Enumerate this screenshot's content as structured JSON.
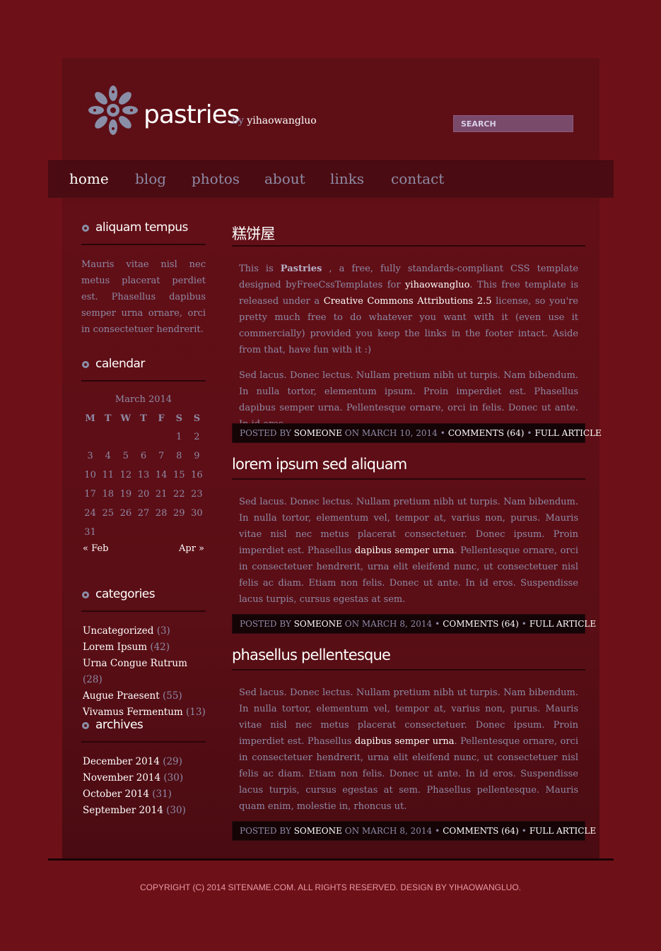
{
  "header": {
    "title": "pastries",
    "by_prefix": "by",
    "by_name": "yihaowangluo",
    "search_label": "SEARCH"
  },
  "nav": {
    "items": [
      {
        "label": "home",
        "active": true
      },
      {
        "label": "blog"
      },
      {
        "label": "photos"
      },
      {
        "label": "about"
      },
      {
        "label": "links"
      },
      {
        "label": "contact"
      }
    ]
  },
  "sidebar": {
    "about": {
      "title": "aliquam tempus",
      "text": "Mauris vitae nisl nec metus placerat perdiet est. Phasellus dapibus semper urna ornare, orci in consectetuer hendrerit."
    },
    "calendar": {
      "title": "calendar",
      "month": "March 2014",
      "days": [
        "M",
        "T",
        "W",
        "T",
        "F",
        "S",
        "S"
      ],
      "weeks": [
        [
          "",
          "",
          "",
          "",
          "",
          "1",
          "2"
        ],
        [
          "3",
          "4",
          "5",
          "6",
          "7",
          "8",
          "9"
        ],
        [
          "10",
          "11",
          "12",
          "13",
          "14",
          "15",
          "16"
        ],
        [
          "17",
          "18",
          "19",
          "20",
          "21",
          "22",
          "23"
        ],
        [
          "24",
          "25",
          "26",
          "27",
          "28",
          "29",
          "30"
        ],
        [
          "31",
          "",
          "",
          "",
          "",
          "",
          ""
        ]
      ],
      "prev": "« Feb",
      "next": "Apr »"
    },
    "categories": {
      "title": "categories",
      "items": [
        {
          "label": "Uncategorized",
          "count": "(3)"
        },
        {
          "label": "Lorem Ipsum",
          "count": "(42)"
        },
        {
          "label": "Urna Congue Rutrum",
          "count": "(28)"
        },
        {
          "label": "Augue Praesent",
          "count": "(55)"
        },
        {
          "label": "Vivamus Fermentum",
          "count": "(13)"
        }
      ]
    },
    "archives": {
      "title": "archives",
      "items": [
        {
          "label": "December 2014",
          "count": "(29)"
        },
        {
          "label": "November 2014",
          "count": "(30)"
        },
        {
          "label": "October 2014",
          "count": "(31)"
        },
        {
          "label": "September 2014",
          "count": "(30)"
        }
      ]
    }
  },
  "posts": [
    {
      "title": "糕饼屋",
      "p1_a": "This is ",
      "p1_b": "Pastries",
      "p1_c": " , a free, fully standards-compliant CSS template designed byFreeCssTemplates for ",
      "p1_d": "yihaowangluo",
      "p1_e": ". This free template is released under a ",
      "p1_f": "Creative Commons Attributions 2.5",
      "p1_g": " license, so you're pretty much free to do whatever you want with it (even use it commercially) provided you keep the links in the footer intact. Aside from that, have fun with it :)",
      "p2": "Sed lacus. Donec lectus. Nullam pretium nibh ut turpis. Nam bibendum. In nulla tortor, elementum ipsum. Proin imperdiet est. Phasellus dapibus semper urna. Pellentesque ornare, orci in felis. Donec ut ante. In id eros.",
      "meta": {
        "posted_by": "POSTED BY",
        "author": "SOMEONE",
        "on": "ON MARCH 10, 2014",
        "comments": "COMMENTS (64)",
        "full": "FULL ARTICLE"
      }
    },
    {
      "title": "lorem ipsum sed aliquam",
      "p1_a": "Sed lacus. Donec lectus. Nullam pretium nibh ut turpis. Nam bibendum. In nulla tortor, elementum vel, tempor at, varius non, purus. Mauris vitae nisl nec metus placerat consectetuer. Donec ipsum. Proin imperdiet est. Phasellus ",
      "p1_b": "dapibus semper urna",
      "p1_c": ". Pellentesque ornare, orci in consectetuer hendrerit, urna elit eleifend nunc, ut consectetuer nisl felis ac diam. Etiam non felis. Donec ut ante. In id eros. Suspendisse lacus turpis, cursus egestas at sem.",
      "meta": {
        "posted_by": "POSTED BY",
        "author": "SOMEONE",
        "on": "ON MARCH 8, 2014",
        "comments": "COMMENTS (64)",
        "full": "FULL ARTICLE"
      }
    },
    {
      "title": "phasellus pellentesque",
      "p1_a": "Sed lacus. Donec lectus. Nullam pretium nibh ut turpis. Nam bibendum. In nulla tortor, elementum vel, tempor at, varius non, purus. Mauris vitae nisl nec metus placerat consectetuer. Donec ipsum. Proin imperdiet est. Phasellus ",
      "p1_b": "dapibus semper urna",
      "p1_c": ". Pellentesque ornare, orci in consectetuer hendrerit, urna elit eleifend nunc, ut consectetuer nisl felis ac diam. Etiam non felis. Donec ut ante. In id eros. Suspendisse lacus turpis, cursus egestas at sem. Phasellus pellentesque. Mauris quam enim, molestie in, rhoncus ut.",
      "meta": {
        "posted_by": "POSTED BY",
        "author": "SOMEONE",
        "on": "ON MARCH 8, 2014",
        "comments": "COMMENTS (64)",
        "full": "FULL ARTICLE"
      }
    }
  ],
  "footer": {
    "copyright": "COPYRIGHT (C) 2014 SITENAME.COM. ALL RIGHTS RESERVED. DESIGN BY YIHAOWANGLUO."
  },
  "colors": {
    "background": "#6e1017",
    "text": "#8f8aa6",
    "heading": "#ffffff",
    "footer_text": "#e69aa6"
  },
  "icons": {
    "logo": "flower-logo-icon",
    "section": "gear-bullet-icon"
  }
}
